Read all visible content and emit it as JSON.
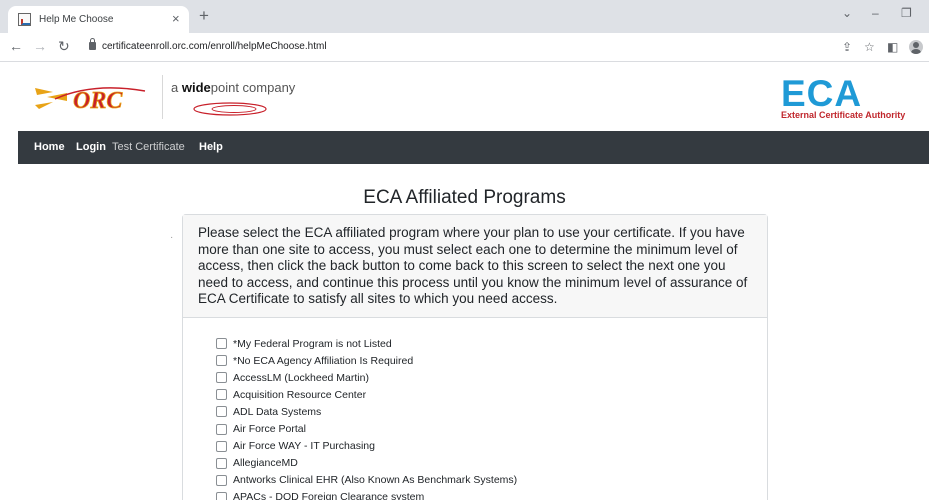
{
  "browser": {
    "tab_title": "Help Me Choose",
    "tab_close": "×",
    "new_tab": "+",
    "url": "certificateenroll.orc.com/enroll/helpMeChoose.html",
    "win_minimize": "–",
    "win_restore": "❐",
    "win_dropdown": "⌄"
  },
  "header": {
    "orc_logo_text": "ORC",
    "widepoint_prefix": "a ",
    "widepoint_bold": "wide",
    "widepoint_suffix": "point company",
    "eca_logo_text": "ECA",
    "eca_tagline": "External Certificate Authority"
  },
  "nav": {
    "items": [
      "Home",
      "Login",
      "Test Certificate",
      "Help"
    ]
  },
  "main": {
    "title": "ECA Affiliated Programs",
    "instructions": "Please select the ECA affiliated program where your plan to use your certificate. If you have more than one site to access, you must select each one to determine the minimum level of access, then click the back button to come back to this screen to select the next one you need to access, and continue this process until you know the minimum level of assurance of ECA Certificate to satisfy all sites to which you need access.",
    "programs": [
      "*My Federal Program is not Listed",
      "*No ECA Agency Affiliation Is Required",
      "AccessLM (Lockheed Martin)",
      "Acquisition Resource Center",
      "ADL Data Systems",
      "Air Force Portal",
      "Air Force WAY - IT Purchasing",
      "AllegianceMD",
      "Antworks Clinical EHR (Also Known As Benchmark Systems)",
      "APACs - DOD Foreign Clearance system"
    ]
  },
  "colors": {
    "navbar_bg": "#343a40",
    "eca_blue": "#1f9ad6",
    "eca_red": "#c0272d",
    "orc_gold": "#e8a317",
    "orc_red": "#c8202a"
  }
}
